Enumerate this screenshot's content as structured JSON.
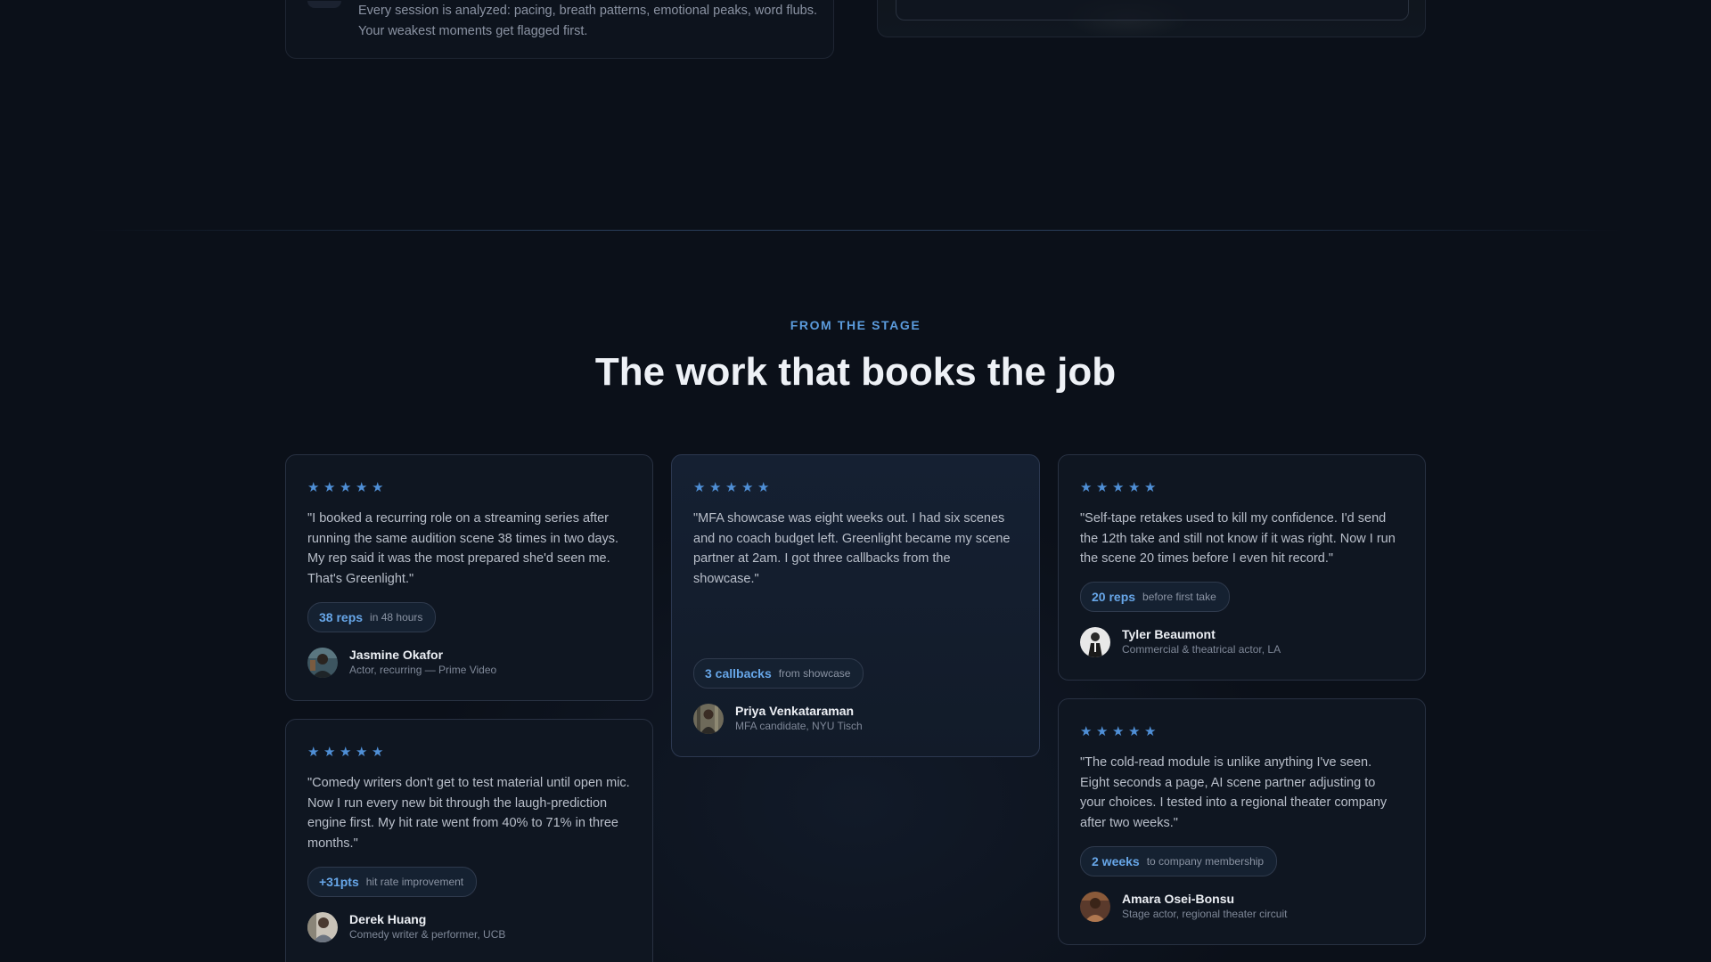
{
  "feature": {
    "description": "Every session is analyzed: pacing, breath patterns, emotional peaks, word flubs. Your weakest moments get flagged first."
  },
  "section": {
    "eyebrow": "FROM THE STAGE",
    "title": "The work that books the job"
  },
  "star_glyph": "★",
  "testimonials": [
    {
      "rating": 5,
      "quote": "\"I booked a recurring role on a streaming series after running the same audition scene 38 times in two days. My rep said it was the most prepared she'd seen me. That's Greenlight.\"",
      "metric_value": "38 reps",
      "metric_label": "in 48 hours",
      "name": "Jasmine Okafor",
      "role": "Actor, recurring — Prime Video"
    },
    {
      "rating": 5,
      "quote": "\"Comedy writers don't get to test material until open mic. Now I run every new bit through the laugh-prediction engine first. My hit rate went from 40% to 71% in three months.\"",
      "metric_value": "+31pts",
      "metric_label": "hit rate improvement",
      "name": "Derek Huang",
      "role": "Comedy writer & performer, UCB"
    },
    {
      "rating": 5,
      "quote": "\"MFA showcase was eight weeks out. I had six scenes and no coach budget left. Greenlight became my scene partner at 2am. I got three callbacks from the showcase.\"",
      "metric_value": "3 callbacks",
      "metric_label": "from showcase",
      "name": "Priya Venkataraman",
      "role": "MFA candidate, NYU Tisch"
    },
    {
      "rating": 5,
      "quote": "\"Self-tape retakes used to kill my confidence. I'd send the 12th take and still not know if it was right. Now I run the scene 20 times before I even hit record.\"",
      "metric_value": "20 reps",
      "metric_label": "before first take",
      "name": "Tyler Beaumont",
      "role": "Commercial & theatrical actor, LA"
    },
    {
      "rating": 5,
      "quote": "\"The cold-read module is unlike anything I've seen. Eight seconds a page, AI scene partner adjusting to your choices. I tested into a regional theater company after two weeks.\"",
      "metric_value": "2 weeks",
      "metric_label": "to company membership",
      "name": "Amara Osei-Bonsu",
      "role": "Stage actor, regional theater circuit"
    }
  ],
  "colors": {
    "background": "#0b1019",
    "accent": "#5b9bdc",
    "star": "#4f8fd6",
    "metric_value": "#67a6e8",
    "card_border": "#283142"
  }
}
